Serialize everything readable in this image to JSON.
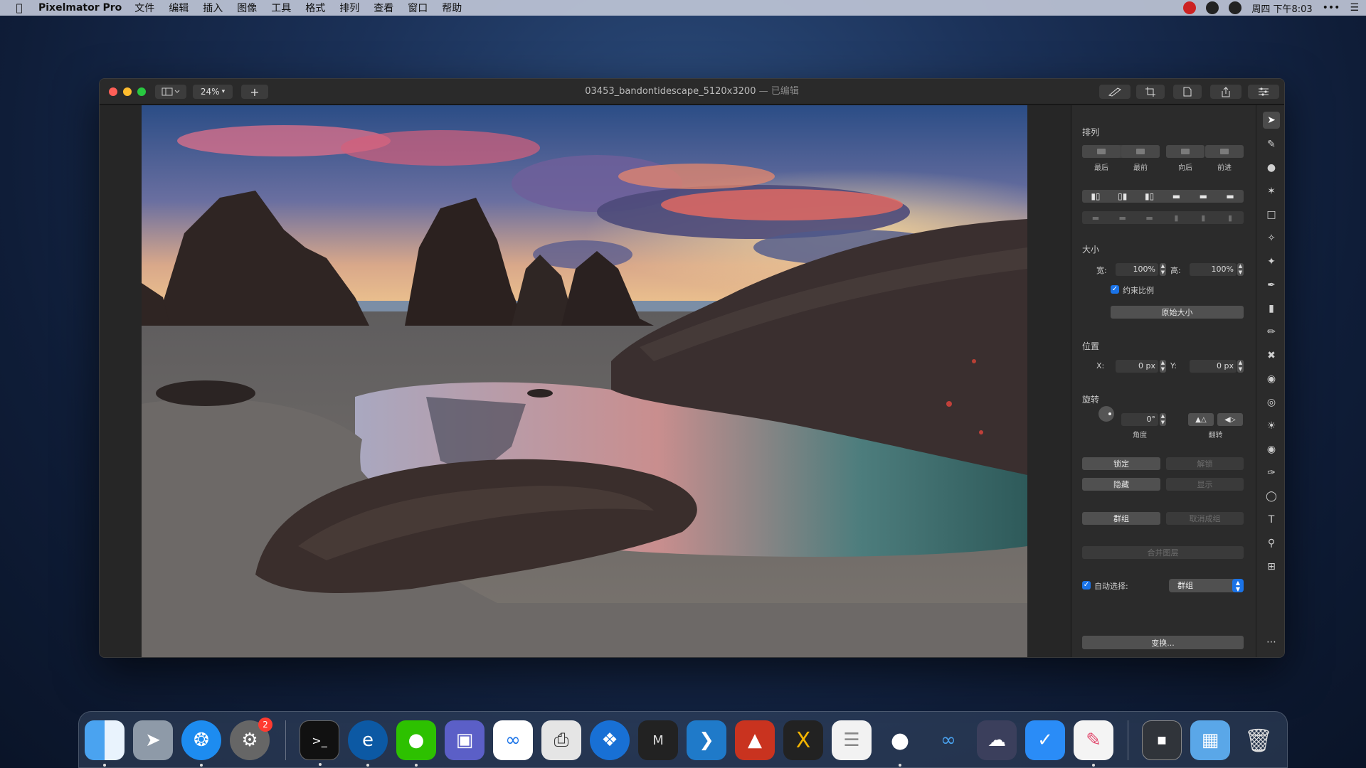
{
  "menubar": {
    "app_name": "Pixelmator Pro",
    "items": [
      "文件",
      "编辑",
      "插入",
      "图像",
      "工具",
      "格式",
      "排列",
      "查看",
      "窗口",
      "帮助"
    ],
    "clock": "周四 下午8:03"
  },
  "window": {
    "zoom": "24%",
    "add_label": "+",
    "title": "03453_bandontidescape_5120x3200",
    "status": " — 已编辑"
  },
  "panel": {
    "arrange_title": "排列",
    "order_buttons": [
      "最后",
      "最前",
      "向后",
      "前进"
    ],
    "size_title": "大小",
    "width_label": "宽:",
    "width_value": "100%",
    "height_label": "高:",
    "height_value": "100%",
    "constrain_label": "约束比例",
    "original_size_button": "原始大小",
    "position_title": "位置",
    "x_label": "X:",
    "x_value": "0 px",
    "y_label": "Y:",
    "y_value": "0 px",
    "rotate_title": "旋转",
    "angle_value": "0°",
    "angle_label": "角度",
    "flip_label": "翻转",
    "lock_button": "锁定",
    "unlock_button": "解锁",
    "hide_button": "隐藏",
    "show_button": "显示",
    "group_button": "群组",
    "ungroup_button": "取消成组",
    "merge_button": "合并图层",
    "auto_select_label": "自动选择:",
    "auto_select_value": "群组",
    "transform_button": "变换..."
  },
  "dock": {
    "settings_badge": "2"
  },
  "colors": {
    "accent": "#1a73e8",
    "close": "#ff5f57",
    "minimize": "#febc2e",
    "maximize": "#28c840"
  }
}
